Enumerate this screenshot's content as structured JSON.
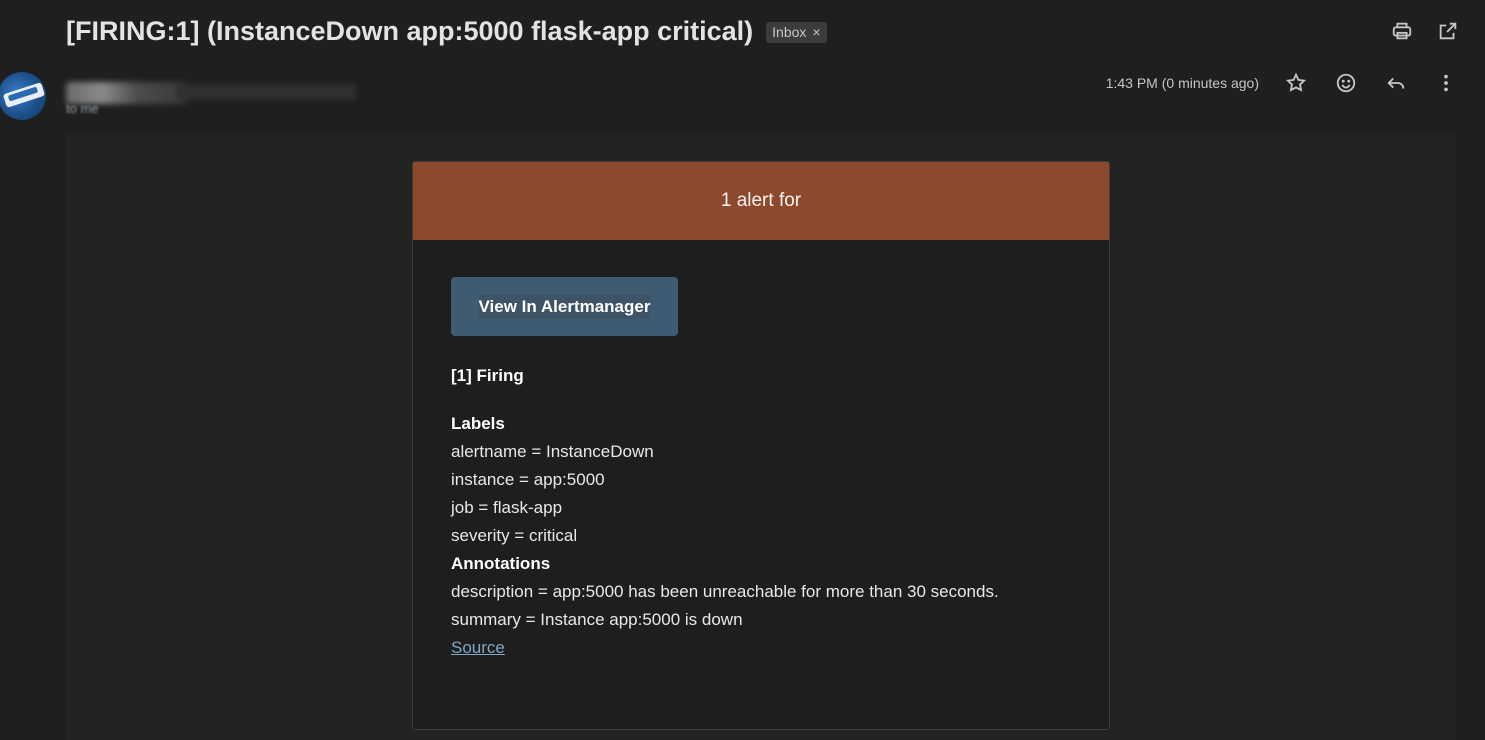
{
  "email": {
    "subject": "[FIRING:1] (InstanceDown app:5000 flask-app critical)",
    "label_chip": "Inbox",
    "label_chip_close": "×",
    "timestamp": "1:43 PM (0 minutes ago)",
    "to_line": "to me"
  },
  "icons": {
    "print": "print-icon",
    "open_new_window": "open-in-new-window-icon",
    "star": "star-icon",
    "emoji": "emoji-icon",
    "reply": "reply-icon",
    "more": "more-vert-icon"
  },
  "alert": {
    "header": "1 alert for",
    "view_button": "View In Alertmanager",
    "firing": "[1] Firing",
    "labels_title": "Labels",
    "labels": [
      "alertname = InstanceDown",
      "instance = app:5000",
      "job = flask-app",
      "severity = critical"
    ],
    "annotations_title": "Annotations",
    "annotations": [
      "description = app:5000 has been unreachable for more than 30 seconds.",
      "summary = Instance app:5000 is down"
    ],
    "source_link": "Source"
  },
  "colors": {
    "header_bg": "#8d492d",
    "button_bg": "#3f5b72",
    "link": "#7fa7c9"
  }
}
